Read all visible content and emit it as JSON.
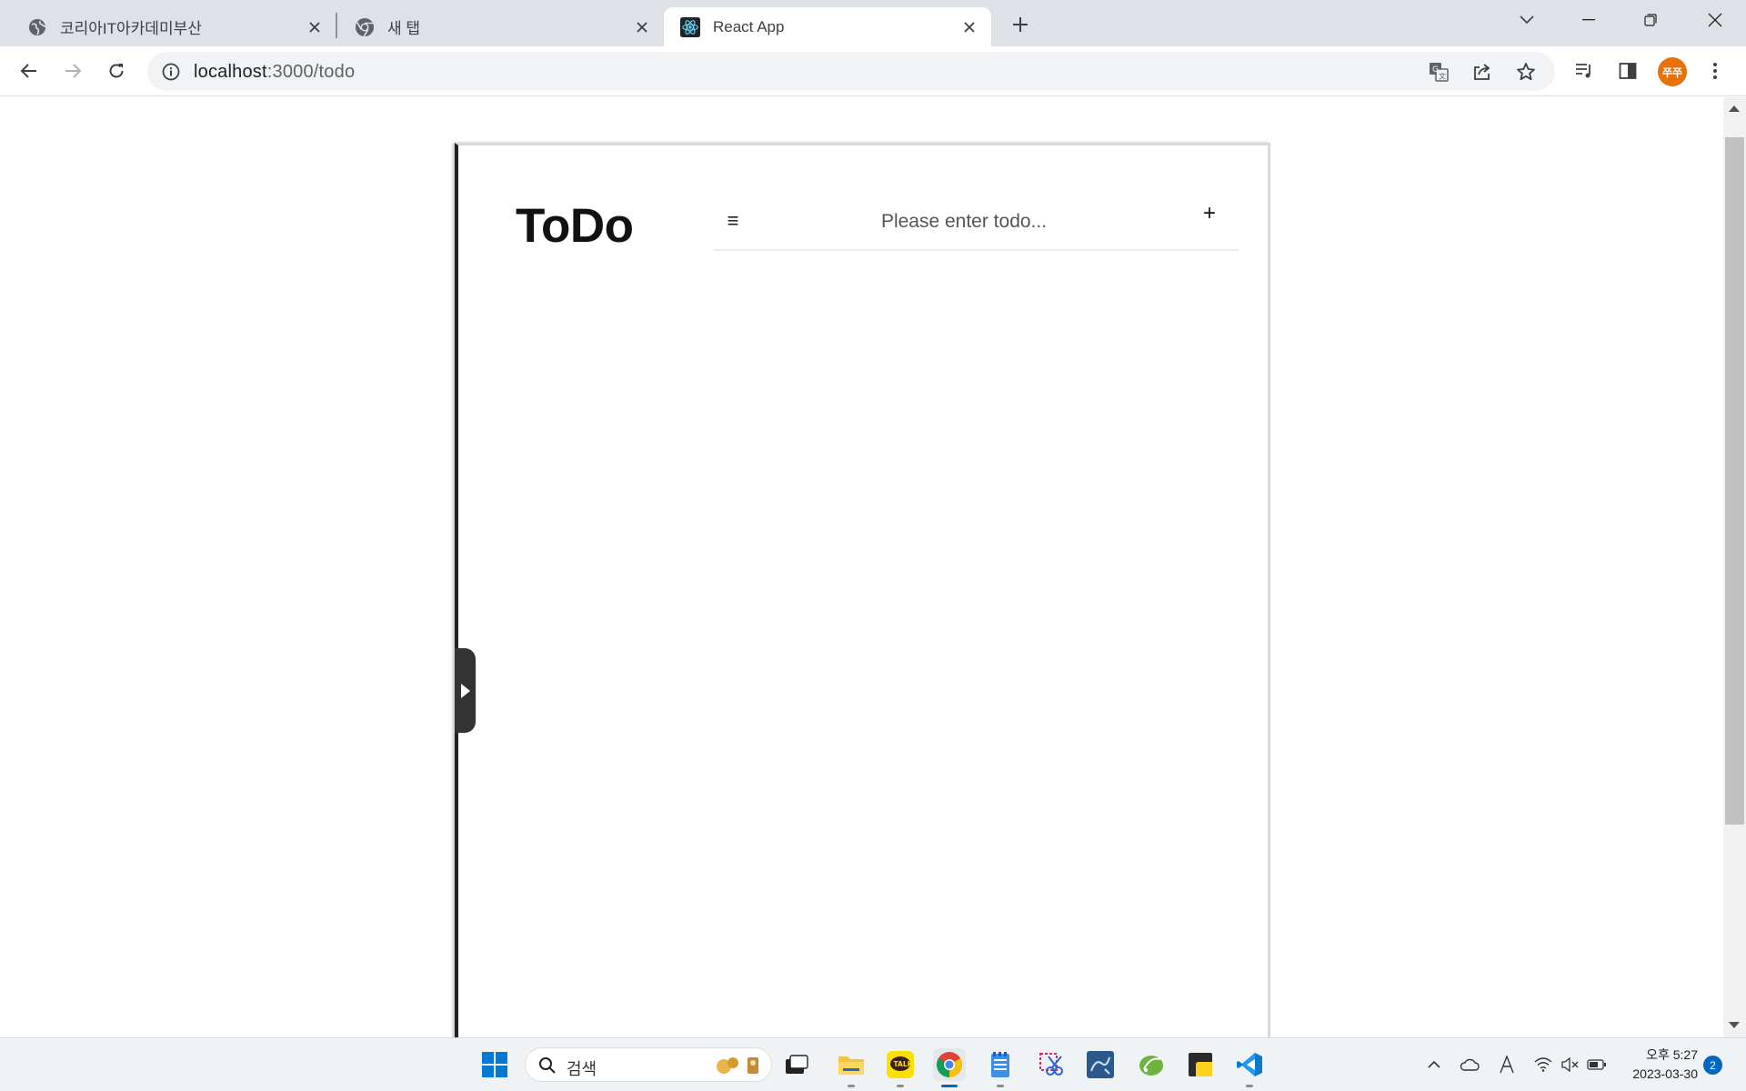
{
  "browser": {
    "tabs": [
      {
        "title": "코리아IT아카데미부산",
        "icon": "globe-icon"
      },
      {
        "title": "새 탭",
        "icon": "chrome-icon"
      },
      {
        "title": "React App",
        "icon": "react-icon",
        "active": true
      }
    ],
    "url_host": "localhost",
    "url_path": ":3000/todo",
    "profile_initials": "쭈쭈",
    "accent": "#e8710a"
  },
  "app": {
    "title": "ToDo",
    "input_placeholder": "Please enter todo...",
    "menu_icon": "≡",
    "add_label": "+"
  },
  "taskbar": {
    "search_label": "검색",
    "clock_time": "오후 5:27",
    "clock_date": "2023-03-30",
    "notification_count": "2"
  }
}
